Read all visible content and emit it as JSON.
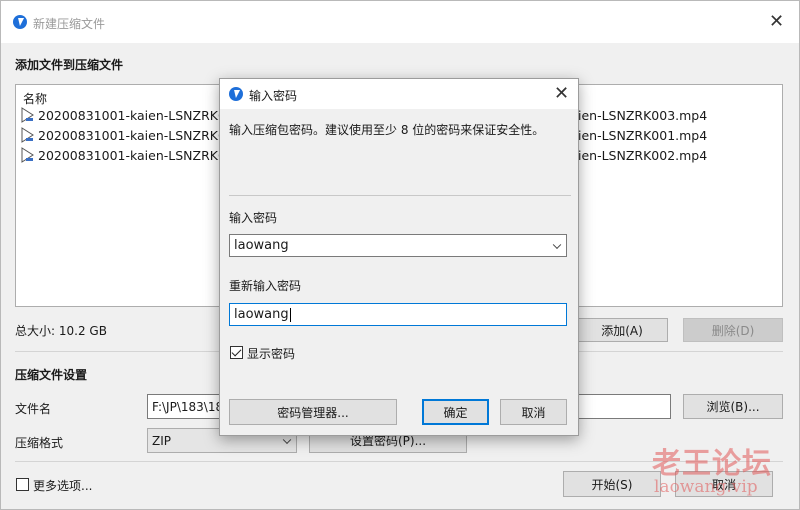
{
  "main": {
    "title": "新建压缩文件",
    "add_files_section": "添加文件到压缩文件",
    "file_list": {
      "column_name": "名称",
      "rows_left": [
        "20200831001-kaien-LSNZRK00",
        "20200831001-kaien-LSNZRK00",
        "20200831001-kaien-LSNZRK00"
      ],
      "rows_right": [
        "ien-LSNZRK003.mp4",
        "ien-LSNZRK001.mp4",
        "ien-LSNZRK002.mp4"
      ]
    },
    "total_size": "总大小: 10.2 GB",
    "add_button": "添加(A)",
    "delete_button": "删除(D)",
    "settings_section": "压缩文件设置",
    "filename_label": "文件名",
    "filename_value": "F:\\JP\\183\\18",
    "browse_button": "浏览(B)...",
    "format_label": "压缩格式",
    "format_value": "ZIP",
    "set_password_button": "设置密码(P)...",
    "more_options": "更多选项...",
    "start_button": "开始(S)",
    "cancel_button": "取消"
  },
  "dialog": {
    "title": "输入密码",
    "instruction": "输入压缩包密码。建议使用至少 8 位的密码来保证安全性。",
    "password_label": "输入密码",
    "password_value": "laowang",
    "reenter_label": "重新输入密码",
    "reenter_value": "laowang",
    "show_password_label": "显示密码",
    "show_password_checked": true,
    "manager_button": "密码管理器...",
    "ok_button": "确定",
    "cancel_button": "取消"
  },
  "watermark": {
    "title": "老王论坛",
    "subtitle": "laowang.vip"
  },
  "colors": {
    "accent": "#0078d7",
    "app_icon": "#1e6fd9",
    "watermark": "#e15a5a"
  },
  "icons": {
    "app": "app-logo-icon",
    "close": "close-icon",
    "file": "video-file-icon",
    "dropdown": "chevron-down-icon",
    "check": "checkmark-icon"
  }
}
